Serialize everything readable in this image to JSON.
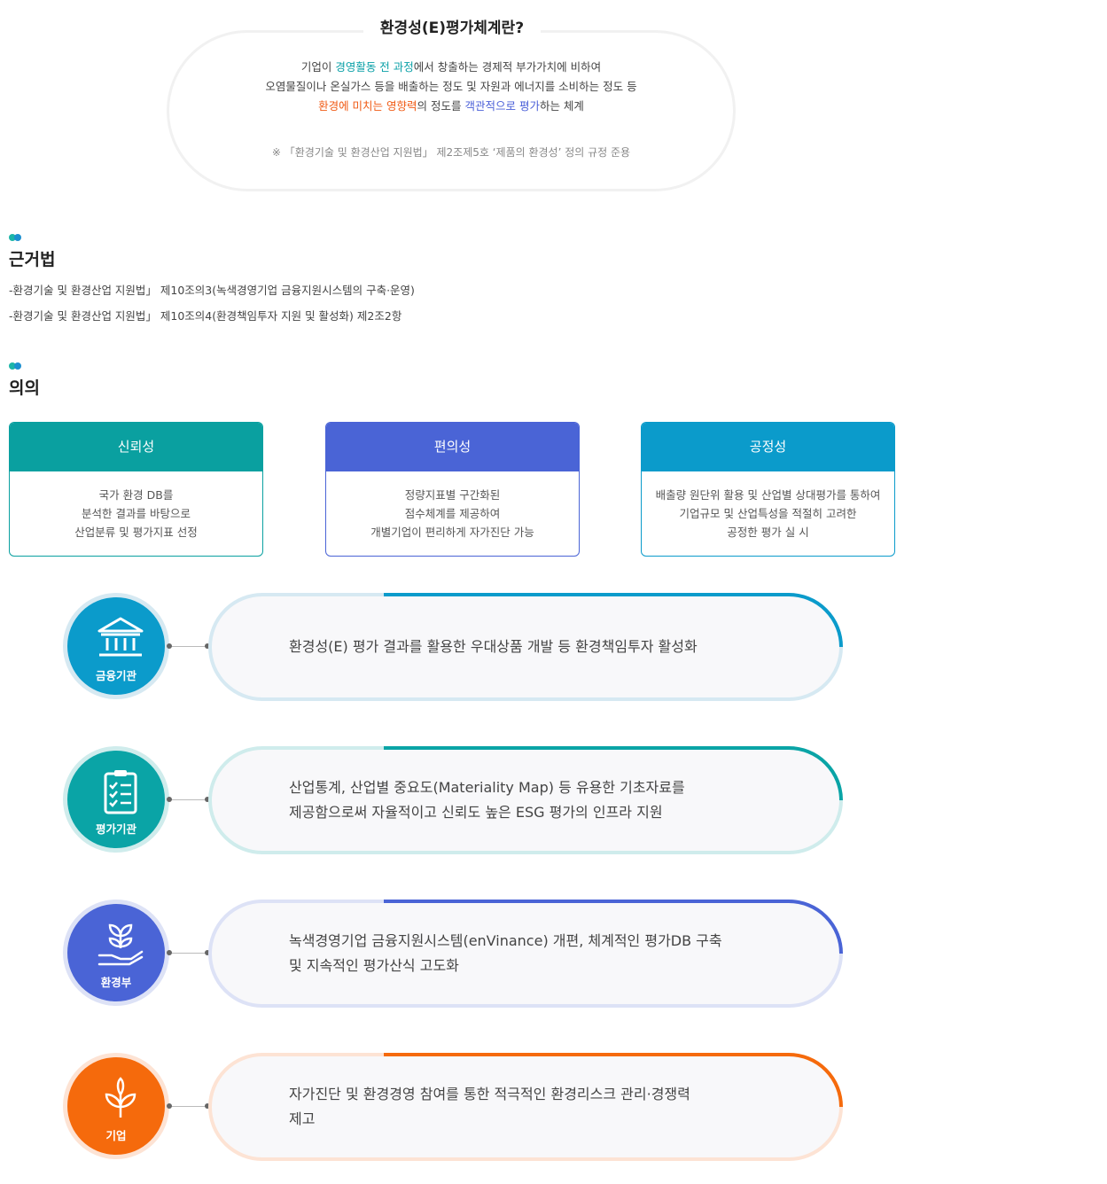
{
  "definition": {
    "title": "환경성(E)평가체계란?",
    "line1": {
      "a": "기업이 ",
      "b": "경영활동 전 과정",
      "c": "에서 창출하는 경제적 부가가치에 비하여"
    },
    "line2": "오염물질이나 온실가스 등을 배출하는 정도 및 자원과 에너지를 소비하는 정도 등",
    "line3": {
      "a": "환경에 미치는 영향력",
      "b": "의 정도를 ",
      "c": "객관적으로 평가",
      "d": "하는 체계"
    },
    "note": "※ 「환경기술 및 환경산업 지원법」 제2조제5호 ‘제품의 환경성’ 정의 규정 준용"
  },
  "legal_basis": {
    "title": "근거법",
    "items": [
      "-환경기술 및 환경산업 지원법」 제10조의3(녹색경영기업 금융지원시스템의 구축·운영)",
      "-환경기술 및 환경산업 지원법」 제10조의4(환경책임투자 지원 및 활성화) 제2조2항"
    ]
  },
  "significance": {
    "title": "의의",
    "cards": [
      {
        "title": "신뢰성",
        "lines": [
          "국가 환경 DB를",
          "분석한 결과를 바탕으로",
          "산업분류 및 평가지표 선정"
        ],
        "color": "#0aa0a0"
      },
      {
        "title": "편의성",
        "lines": [
          "정량지표별 구간화된",
          "점수체계를 제공하여",
          "개별기업이 편리하게 자가진단 가능"
        ],
        "color": "#4a64d6"
      },
      {
        "title": "공정성",
        "lines": [
          "배출량 원단위 활용 및 산업별 상대평가를 통하여",
          "기업규모 및 산업특성을 적절히 고려한",
          "공정한 평가 실 시"
        ],
        "color": "#0b9bcb"
      }
    ]
  },
  "roles": [
    {
      "label": "금융기관",
      "icon": "bank-icon",
      "color": "#0b9bcb",
      "light": "#d6e9f2",
      "lines": [
        "환경성(E) 평가 결과를 활용한 우대상품 개발 등 환경책임투자 활성화"
      ]
    },
    {
      "label": "평가기관",
      "icon": "clipboard-checklist-icon",
      "color": "#0aa4a6",
      "light": "#cfecec",
      "lines": [
        "산업통계, 산업별 중요도(Materiality Map) 등 유용한 기초자료를",
        "제공함으로써 자율적이고 신뢰도 높은 ESG 평가의 인프라 지원"
      ]
    },
    {
      "label": "환경부",
      "icon": "plant-in-hand-icon",
      "color": "#4a64d6",
      "light": "#dde2f6",
      "lines": [
        "녹색경영기업 금융지원시스템(enVinance) 개편, 체계적인 평가DB 구축",
        "및 지속적인 평가산식 고도화"
      ]
    },
    {
      "label": "기업",
      "icon": "sprout-icon",
      "color": "#f56a0c",
      "light": "#fde3d4",
      "lines": [
        "자가진단 및 환경경영 참여를 통한 적극적인 환경리스크 관리·경쟁력",
        "제고"
      ]
    }
  ]
}
